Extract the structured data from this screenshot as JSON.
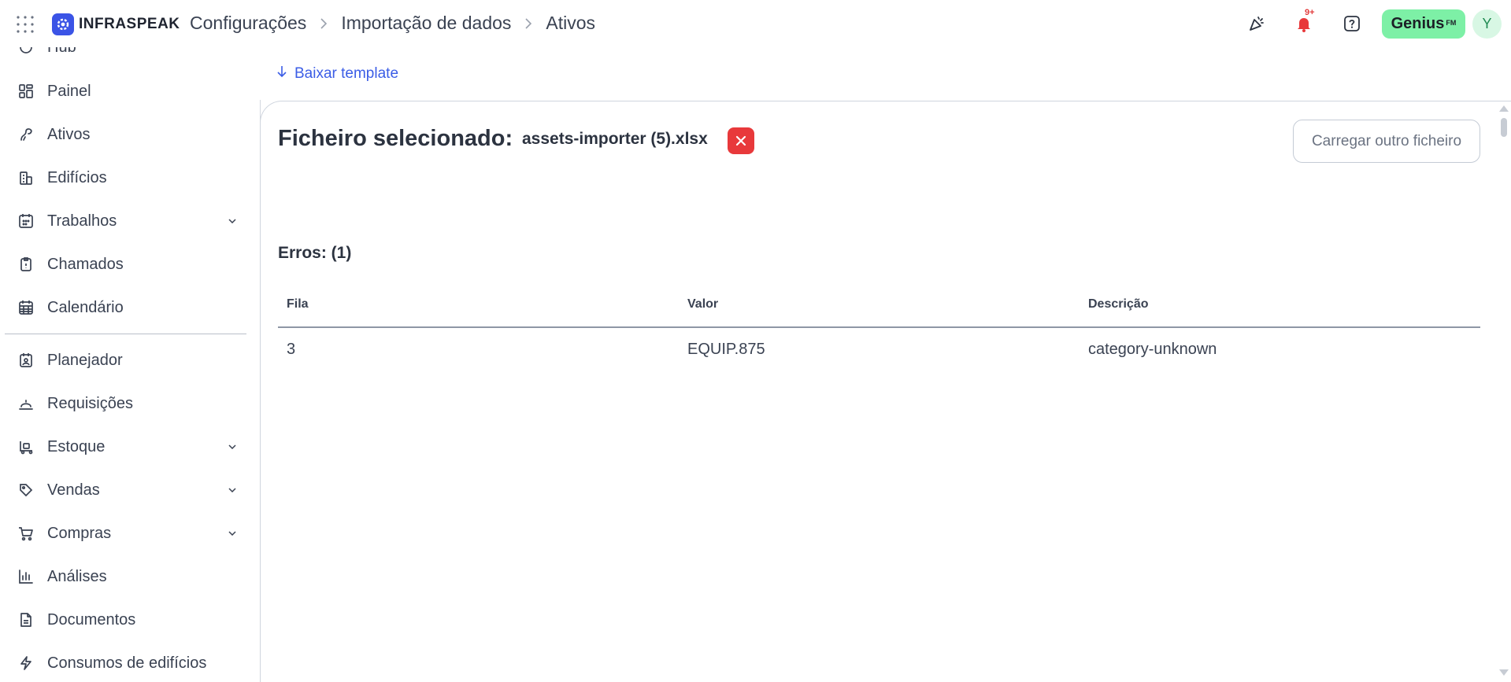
{
  "header": {
    "logo_text": "INFRASPEAK",
    "breadcrumbs": [
      "Configurações",
      "Importação de dados",
      "Ativos"
    ],
    "notification_badge": "9+",
    "genius_label": "Genius",
    "genius_suffix": "FM",
    "avatar_initial": "Y"
  },
  "sidebar": {
    "items": [
      {
        "label": "Hub",
        "icon": "hub-icon"
      },
      {
        "label": "Painel",
        "icon": "dashboard-icon"
      },
      {
        "label": "Ativos",
        "icon": "assets-icon"
      },
      {
        "label": "Edifícios",
        "icon": "building-icon"
      },
      {
        "label": "Trabalhos",
        "icon": "calendar-grid-icon"
      },
      {
        "label": "Chamados",
        "icon": "clipboard-icon"
      },
      {
        "label": "Calendário",
        "icon": "calendar-icon"
      },
      {
        "label": "Planejador",
        "icon": "planner-icon"
      },
      {
        "label": "Requisições",
        "icon": "bell-service-icon"
      },
      {
        "label": "Estoque",
        "icon": "stock-icon"
      },
      {
        "label": "Vendas",
        "icon": "tag-icon"
      },
      {
        "label": "Compras",
        "icon": "cart-icon"
      },
      {
        "label": "Análises",
        "icon": "bar-chart-icon"
      },
      {
        "label": "Documentos",
        "icon": "document-icon"
      },
      {
        "label": "Consumos de edifícios",
        "icon": "lightning-icon"
      }
    ]
  },
  "main": {
    "download_label": "Baixar template",
    "selected_label": "Ficheiro selecionado:",
    "file_name": "assets-importer (5).xlsx",
    "upload_other_label": "Carregar outro ficheiro",
    "errors_title": "Erros: (1)",
    "table": {
      "headers": [
        "Fila",
        "Valor",
        "Descrição"
      ],
      "rows": [
        [
          "3",
          "EQUIP.875",
          "category-unknown"
        ]
      ]
    }
  },
  "colors": {
    "accent": "#3b54e6",
    "danger": "#e8393b",
    "genius": "#7df0a6"
  }
}
